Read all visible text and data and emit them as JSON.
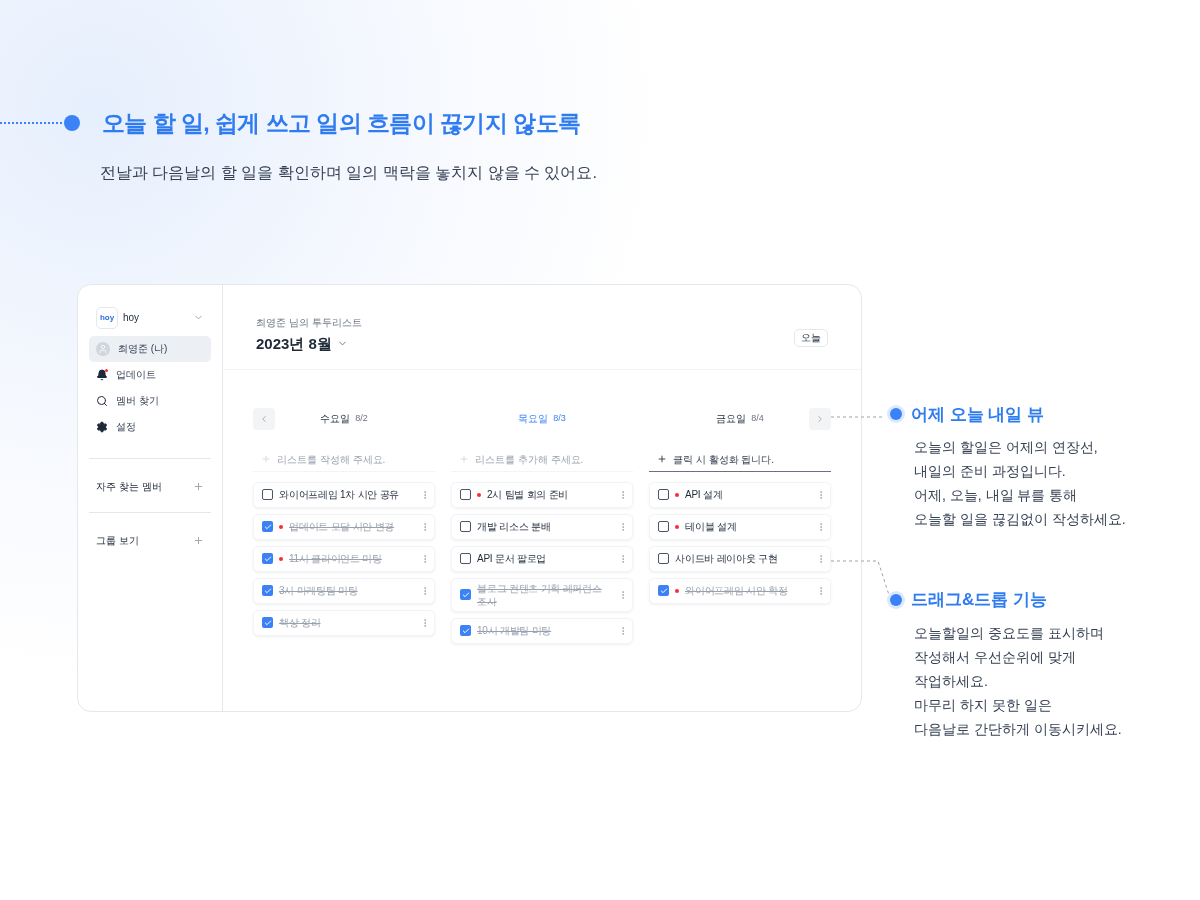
{
  "heading": {
    "title": "오늘 할 일, 쉽게 쓰고 일의 흐름이 끊기지 않도록",
    "subtitle": "전날과 다음날의 할 일을 확인하며 일의 맥락을 놓치지 않을 수 있어요."
  },
  "app": {
    "sidebar": {
      "logo": "hoy",
      "workspace": "hoy",
      "nav": [
        {
          "kind": "profile",
          "label": "최영준 (나)",
          "selected": true
        },
        {
          "kind": "updates",
          "label": "업데이트",
          "selected": false
        },
        {
          "kind": "search",
          "label": "멤버 찾기",
          "selected": false
        },
        {
          "kind": "settings",
          "label": "설정",
          "selected": false
        }
      ],
      "sections": [
        {
          "label": "자주 찾는 멤버"
        },
        {
          "label": "그룹 보기"
        }
      ]
    },
    "header": {
      "caption": "최영준 님의 투두리스트",
      "month": "2023년 8월",
      "today_button": "오늘"
    },
    "days": [
      {
        "label": "수요일",
        "date": "8/2",
        "selected": false,
        "input": {
          "placeholder": "리스트를 작성해 주세요.",
          "active": false
        },
        "tasks": [
          {
            "text": "와이어프레임 1차 시안 공유",
            "checked": false,
            "important": false
          },
          {
            "text": "업데이트 모달 시안 변경",
            "checked": true,
            "important": true
          },
          {
            "text": "11시 클라이언트 미팅",
            "checked": true,
            "important": true
          },
          {
            "text": "3시 마케팅팀 미팅",
            "checked": true,
            "important": false
          },
          {
            "text": "책상 정리",
            "checked": true,
            "important": false
          }
        ]
      },
      {
        "label": "목요일",
        "date": "8/3",
        "selected": true,
        "input": {
          "placeholder": "리스트를 추가해 주세요.",
          "active": false
        },
        "tasks": [
          {
            "text": "2시 팀별 회의 준비",
            "checked": false,
            "important": true
          },
          {
            "text": "개발 리소스 분배",
            "checked": false,
            "important": false
          },
          {
            "text": "API 문서 팔로업",
            "checked": false,
            "important": false
          },
          {
            "text": "블로그 컨텐츠 기획 레퍼런스 조사",
            "checked": true,
            "important": false
          },
          {
            "text": "10시 개발팀 미팅",
            "checked": true,
            "important": false
          }
        ]
      },
      {
        "label": "금요일",
        "date": "8/4",
        "selected": false,
        "input": {
          "placeholder": "클릭 시 활성화 됩니다.",
          "active": true
        },
        "tasks": [
          {
            "text": "API 설계",
            "checked": false,
            "important": true
          },
          {
            "text": "테이블 설계",
            "checked": false,
            "important": true
          },
          {
            "text": "사이드바 레이아웃 구현",
            "checked": false,
            "important": false
          },
          {
            "text": "와이어프레임 시안 확정",
            "checked": true,
            "important": true
          }
        ]
      }
    ]
  },
  "annotations": [
    {
      "title": "어제 오늘 내일 뷰",
      "lines": [
        "오늘의 할일은 어제의 연장선,",
        "내일의 준비 과정입니다.",
        "어제, 오늘, 내일 뷰를 통해",
        "오늘할 일을 끊김없이 작성하세요."
      ]
    },
    {
      "title": "드래그&드롭 기능",
      "lines": [
        "오늘할일의 중요도를 표시하며",
        "작성해서 우선순위에 맞게",
        "작업하세요.",
        "마무리 하지 못한 일은",
        "다음날로 간단하게 이동시키세요."
      ]
    }
  ]
}
